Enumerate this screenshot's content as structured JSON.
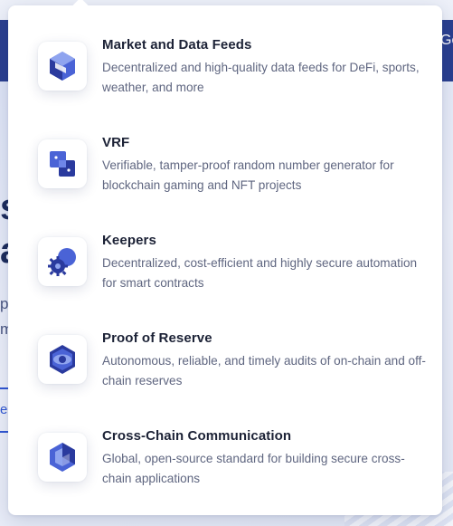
{
  "background": {
    "header_edge_text": "Go",
    "hero_heading_fragment": "s\na",
    "hero_sub_fragment": "p\nm",
    "hero_link_fragment": "e"
  },
  "menu": {
    "items": [
      {
        "title": "Market and Data Feeds",
        "description": "Decentralized and high-quality data feeds for DeFi, sports, weather, and more",
        "icon": "market-data-feeds-icon"
      },
      {
        "title": "VRF",
        "description": "Verifiable, tamper-proof random number generator for blockchain gaming and NFT projects",
        "icon": "vrf-icon"
      },
      {
        "title": "Keepers",
        "description": "Decentralized, cost-efficient and highly secure automation for smart contracts",
        "icon": "keepers-icon"
      },
      {
        "title": "Proof of Reserve",
        "description": "Autonomous, reliable, and timely audits of on-chain and off-chain reserves",
        "icon": "proof-of-reserve-icon"
      },
      {
        "title": "Cross-Chain Communication",
        "description": "Global, open-source standard for building secure cross-chain applications",
        "icon": "cross-chain-icon"
      }
    ]
  },
  "colors": {
    "icon_dark": "#2a3a9e",
    "icon_mid": "#4a63d6",
    "icon_light": "#8fa4ef",
    "header": "#2a3f8f"
  }
}
